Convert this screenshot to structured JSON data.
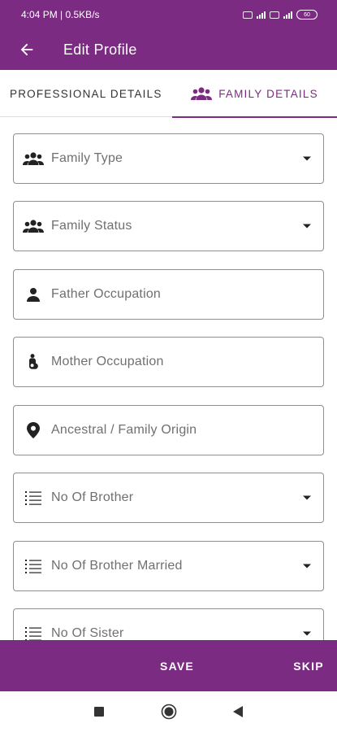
{
  "status_bar": {
    "time": "4:04 PM",
    "speed": "0.5KB/s",
    "battery": "60"
  },
  "header": {
    "title": "Edit Profile",
    "back_icon": "arrow-left-icon"
  },
  "tabs": [
    {
      "label": "PROFESSIONAL DETAILS",
      "active": false
    },
    {
      "label": "FAMILY DETAILS",
      "active": true,
      "icon": "people-icon"
    }
  ],
  "fields": [
    {
      "label": "Family Type",
      "icon": "people-icon",
      "dropdown": true
    },
    {
      "label": "Family Status",
      "icon": "people-icon",
      "dropdown": true
    },
    {
      "label": "Father Occupation",
      "icon": "person-icon",
      "dropdown": false
    },
    {
      "label": "Mother Occupation",
      "icon": "mother-icon",
      "dropdown": false
    },
    {
      "label": "Ancestral / Family Origin",
      "icon": "location-pin-icon",
      "dropdown": false
    },
    {
      "label": "No Of Brother",
      "icon": "list-icon",
      "dropdown": true
    },
    {
      "label": "No Of Brother Married",
      "icon": "list-icon",
      "dropdown": true
    },
    {
      "label": "No Of Sister",
      "icon": "list-icon",
      "dropdown": true
    }
  ],
  "actions": {
    "save_label": "SAVE",
    "skip_label": "SKIP"
  },
  "colors": {
    "primary": "#7b2b82",
    "field_border": "#8f8f8f",
    "label_text": "#707070"
  }
}
